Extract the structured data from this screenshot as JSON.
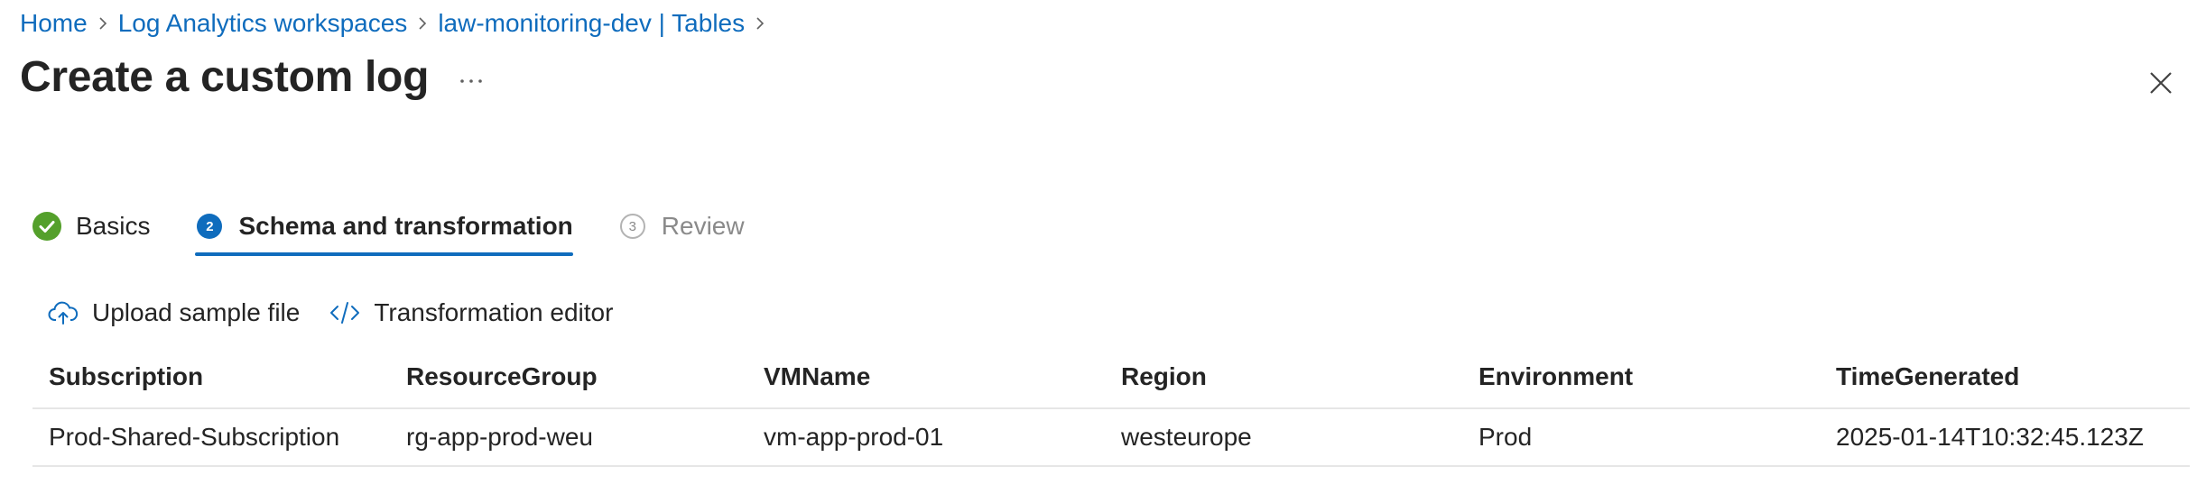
{
  "breadcrumb": {
    "items": [
      "Home",
      "Log Analytics workspaces",
      "law-monitoring-dev | Tables"
    ]
  },
  "header": {
    "title": "Create a custom log",
    "more_label": "···"
  },
  "wizard": {
    "steps": [
      {
        "number": "",
        "label": "Basics",
        "state": "done"
      },
      {
        "number": "2",
        "label": "Schema and transformation",
        "state": "active"
      },
      {
        "number": "3",
        "label": "Review",
        "state": "pending"
      }
    ]
  },
  "toolbar": {
    "upload_label": "Upload sample file",
    "transform_label": "Transformation editor"
  },
  "table": {
    "columns": [
      "Subscription",
      "ResourceGroup",
      "VMName",
      "Region",
      "Environment",
      "TimeGenerated"
    ],
    "rows": [
      [
        "Prod-Shared-Subscription",
        "rg-app-prod-weu",
        "vm-app-prod-01",
        "westeurope",
        "Prod",
        "2025-01-14T10:32:45.123Z"
      ]
    ]
  },
  "colors": {
    "link": "#0f6cbd",
    "success": "#54a02b",
    "active": "#0f6cbd",
    "text": "#242424",
    "muted": "#8a8a8a"
  },
  "icons": {
    "breadcrumb_separator": "chevron-right-icon",
    "more": "more-horizontal-icon",
    "close": "close-icon",
    "step_done": "checkmark-circle-icon",
    "upload": "cloud-upload-icon",
    "transform": "code-icon"
  }
}
